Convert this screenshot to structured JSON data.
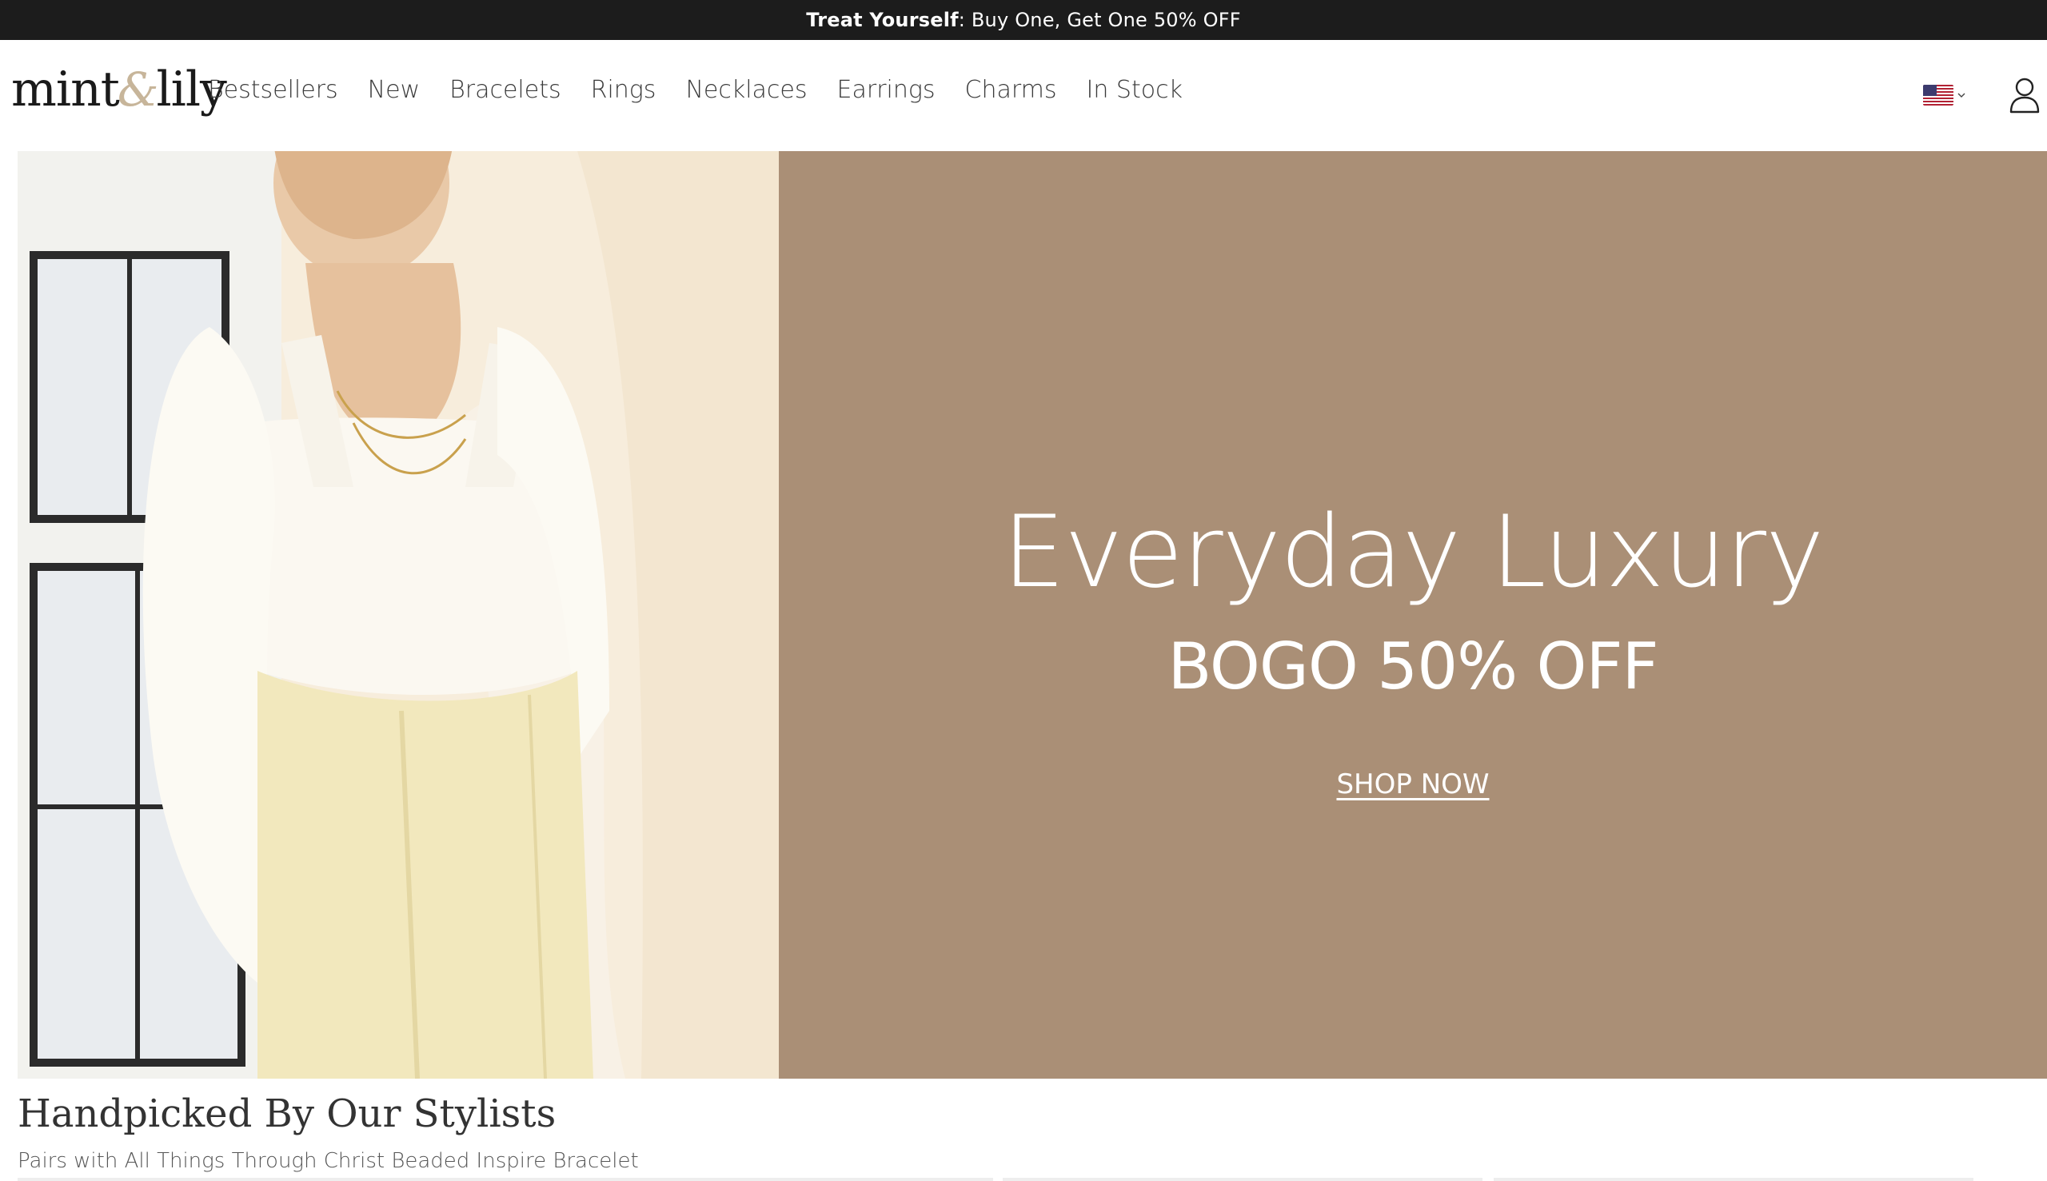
{
  "announcement": {
    "strong": "Treat Yourself",
    "text": ": Buy One, Get One 50% OFF"
  },
  "header": {
    "logo_left": "mint",
    "logo_amp": "&",
    "logo_right": "lily",
    "nav": [
      {
        "label": "Bestsellers"
      },
      {
        "label": "New"
      },
      {
        "label": "Bracelets"
      },
      {
        "label": "Rings"
      },
      {
        "label": "Necklaces"
      },
      {
        "label": "Earrings"
      },
      {
        "label": "Charms"
      },
      {
        "label": "In Stock"
      }
    ],
    "locale_icon": "us-flag-icon",
    "account_icon": "user-icon"
  },
  "hero": {
    "title": "Everyday Luxury",
    "subtitle": "BOGO 50% OFF",
    "cta": "SHOP NOW",
    "panel_color": "#aa8f76"
  },
  "section": {
    "title": "Handpicked By Our Stylists",
    "subtitle": "Pairs with All Things Through Christ Beaded Inspire Bracelet"
  },
  "colors": {
    "announcement_bg": "#1c1c1c",
    "accent": "#c7b59a"
  }
}
